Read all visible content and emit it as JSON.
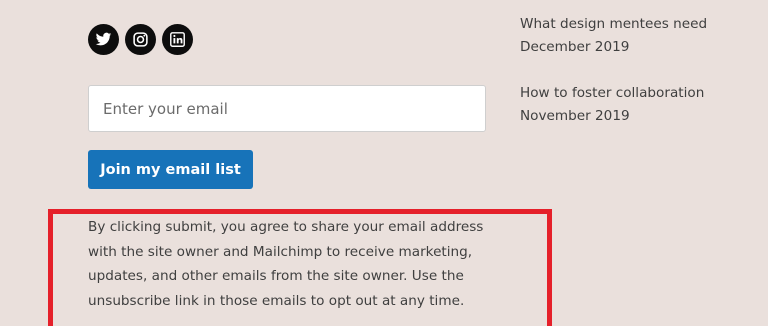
{
  "social": [
    {
      "name": "twitter-icon"
    },
    {
      "name": "instagram-icon"
    },
    {
      "name": "linkedin-icon"
    }
  ],
  "signup": {
    "email_placeholder": "Enter your email",
    "join_label": "Join my email list",
    "consent": "By clicking submit, you agree to share your email address with the site owner and Mailchimp to receive marketing, updates, and other emails from the site owner. Use the unsubscribe link in those emails to opt out at any time."
  },
  "posts": [
    {
      "title": "What design mentees need",
      "date": "December 2019"
    },
    {
      "title": "How to foster collaboration",
      "date": "November 2019"
    }
  ],
  "colors": {
    "background": "#eae0dc",
    "button": "#1773b9",
    "highlight_border": "#e5202a",
    "icon_circle": "#0d0d0d"
  }
}
